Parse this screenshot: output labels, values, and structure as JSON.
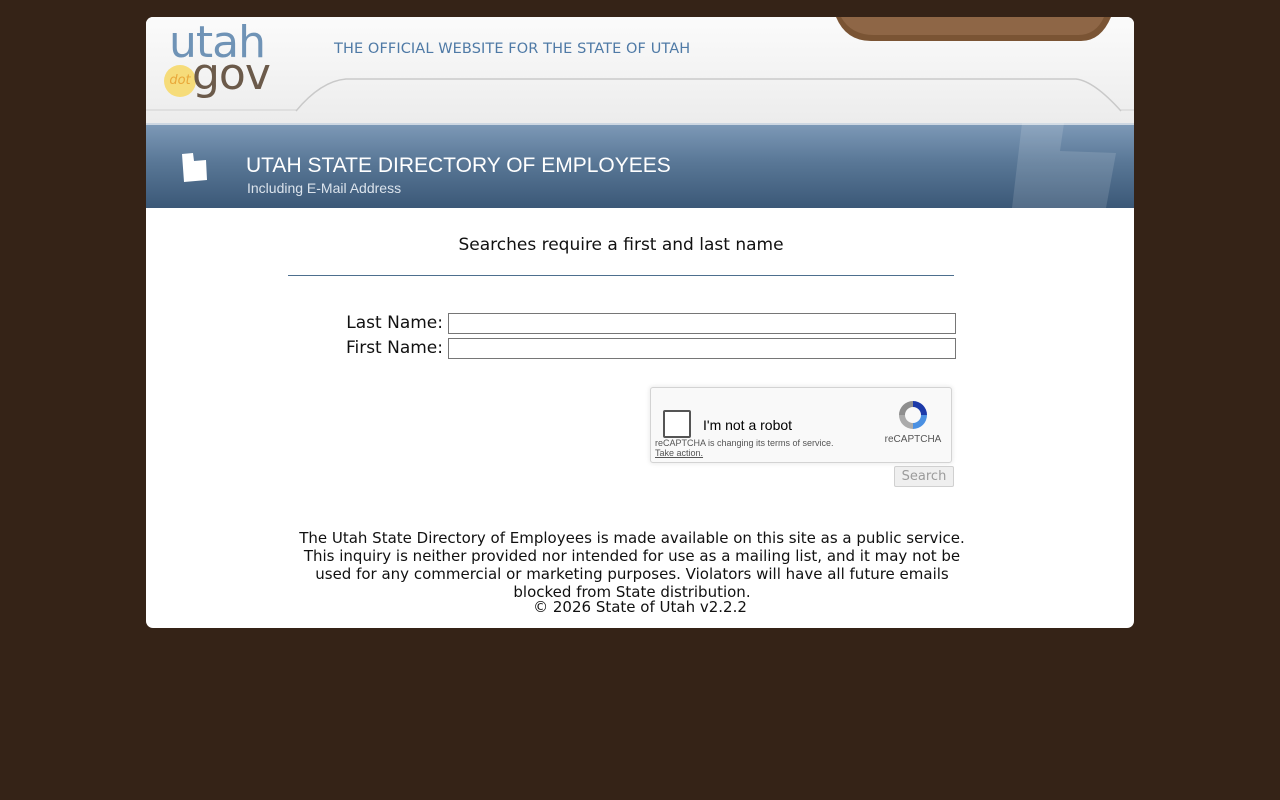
{
  "header": {
    "logo_text_1": "utah",
    "logo_text_2": "dot",
    "logo_text_3": "gov",
    "tagline": "THE OFFICIAL WEBSITE FOR THE STATE OF UTAH"
  },
  "banner": {
    "title": "UTAH STATE DIRECTORY OF EMPLOYEES",
    "subtitle": "Including E-Mail Address",
    "icon": "utah-state-icon"
  },
  "search": {
    "heading": "Searches require a first and last name",
    "last_name_label": "Last Name:",
    "last_name_value": "",
    "first_name_label": "First Name:",
    "first_name_value": "",
    "button_label": "Search"
  },
  "recaptcha": {
    "label": "I'm not a robot",
    "notice": "reCAPTCHA is changing its terms of service.",
    "link": "Take action.",
    "brand": "reCAPTCHA"
  },
  "footer": {
    "disclaimer": "The Utah State Directory of Employees is made available on this site as a public service. This inquiry is neither provided nor intended for use as a mailing list, and it may not be used for any commercial or marketing purposes. Violators will have all future emails blocked from State distribution.",
    "copyright": "© 2026 State of Utah v2.2.2"
  },
  "colors": {
    "page_background": "#352317",
    "banner_blue": "#4f6f90",
    "accent_brown": "#7a5030"
  }
}
